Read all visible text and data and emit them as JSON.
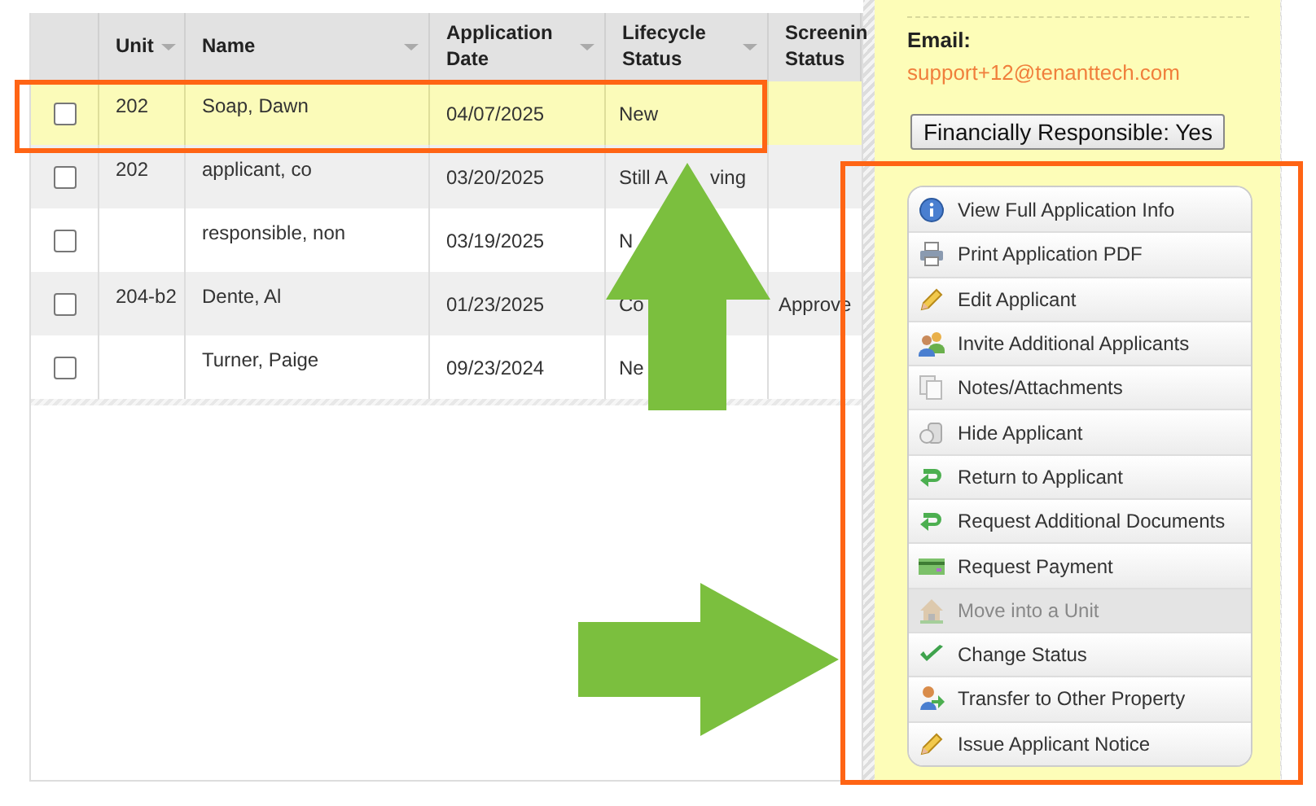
{
  "table": {
    "columns": [
      {
        "label": "Unit",
        "sortable": true
      },
      {
        "label": "Name",
        "sortable": true
      },
      {
        "label": "Application Date",
        "sortable": true
      },
      {
        "label": "Lifecycle Status",
        "sortable": true
      },
      {
        "label": "Screenin Status",
        "sortable": false
      }
    ],
    "rows": [
      {
        "selected": true,
        "checked": false,
        "unit": "202",
        "name": "Soap, Dawn",
        "date": "04/07/2025",
        "lifecycle": "New",
        "screening": ""
      },
      {
        "selected": false,
        "checked": false,
        "unit": "202",
        "name": "applicant, co",
        "date": "03/20/2025",
        "lifecycle": "Still A",
        "lifecycle_tail": "ving",
        "screening": ""
      },
      {
        "selected": false,
        "checked": false,
        "unit": "",
        "name": "responsible, non",
        "date": "03/19/2025",
        "lifecycle": "N",
        "screening": ""
      },
      {
        "selected": false,
        "checked": false,
        "unit": "204-b2",
        "name": "Dente, Al",
        "date": "01/23/2025",
        "lifecycle": "Co",
        "screening": "Approve"
      },
      {
        "selected": false,
        "checked": false,
        "unit": "",
        "name": "Turner, Paige",
        "date": "09/23/2024",
        "lifecycle": "Ne",
        "screening": ""
      }
    ]
  },
  "panel": {
    "email_label": "Email:",
    "email": "support+12@tenanttech.com",
    "responsible_button": "Financially Responsible: Yes",
    "actions": [
      {
        "label": "View Full Application Info",
        "disabled": false
      },
      {
        "label": "Print Application PDF",
        "disabled": false
      },
      {
        "label": "Edit Applicant",
        "disabled": false
      },
      {
        "label": "Invite Additional Applicants",
        "disabled": false
      },
      {
        "label": "Notes/Attachments",
        "disabled": false
      },
      {
        "label": "Hide Applicant",
        "disabled": false
      },
      {
        "label": "Return to Applicant",
        "disabled": false
      },
      {
        "label": "Request Additional Documents",
        "disabled": false
      },
      {
        "label": "Request Payment",
        "disabled": false
      },
      {
        "label": "Move into a Unit",
        "disabled": true
      },
      {
        "label": "Change Status",
        "disabled": false
      },
      {
        "label": "Transfer to Other Property",
        "disabled": false
      },
      {
        "label": "Issue Applicant Notice",
        "disabled": false
      }
    ]
  }
}
